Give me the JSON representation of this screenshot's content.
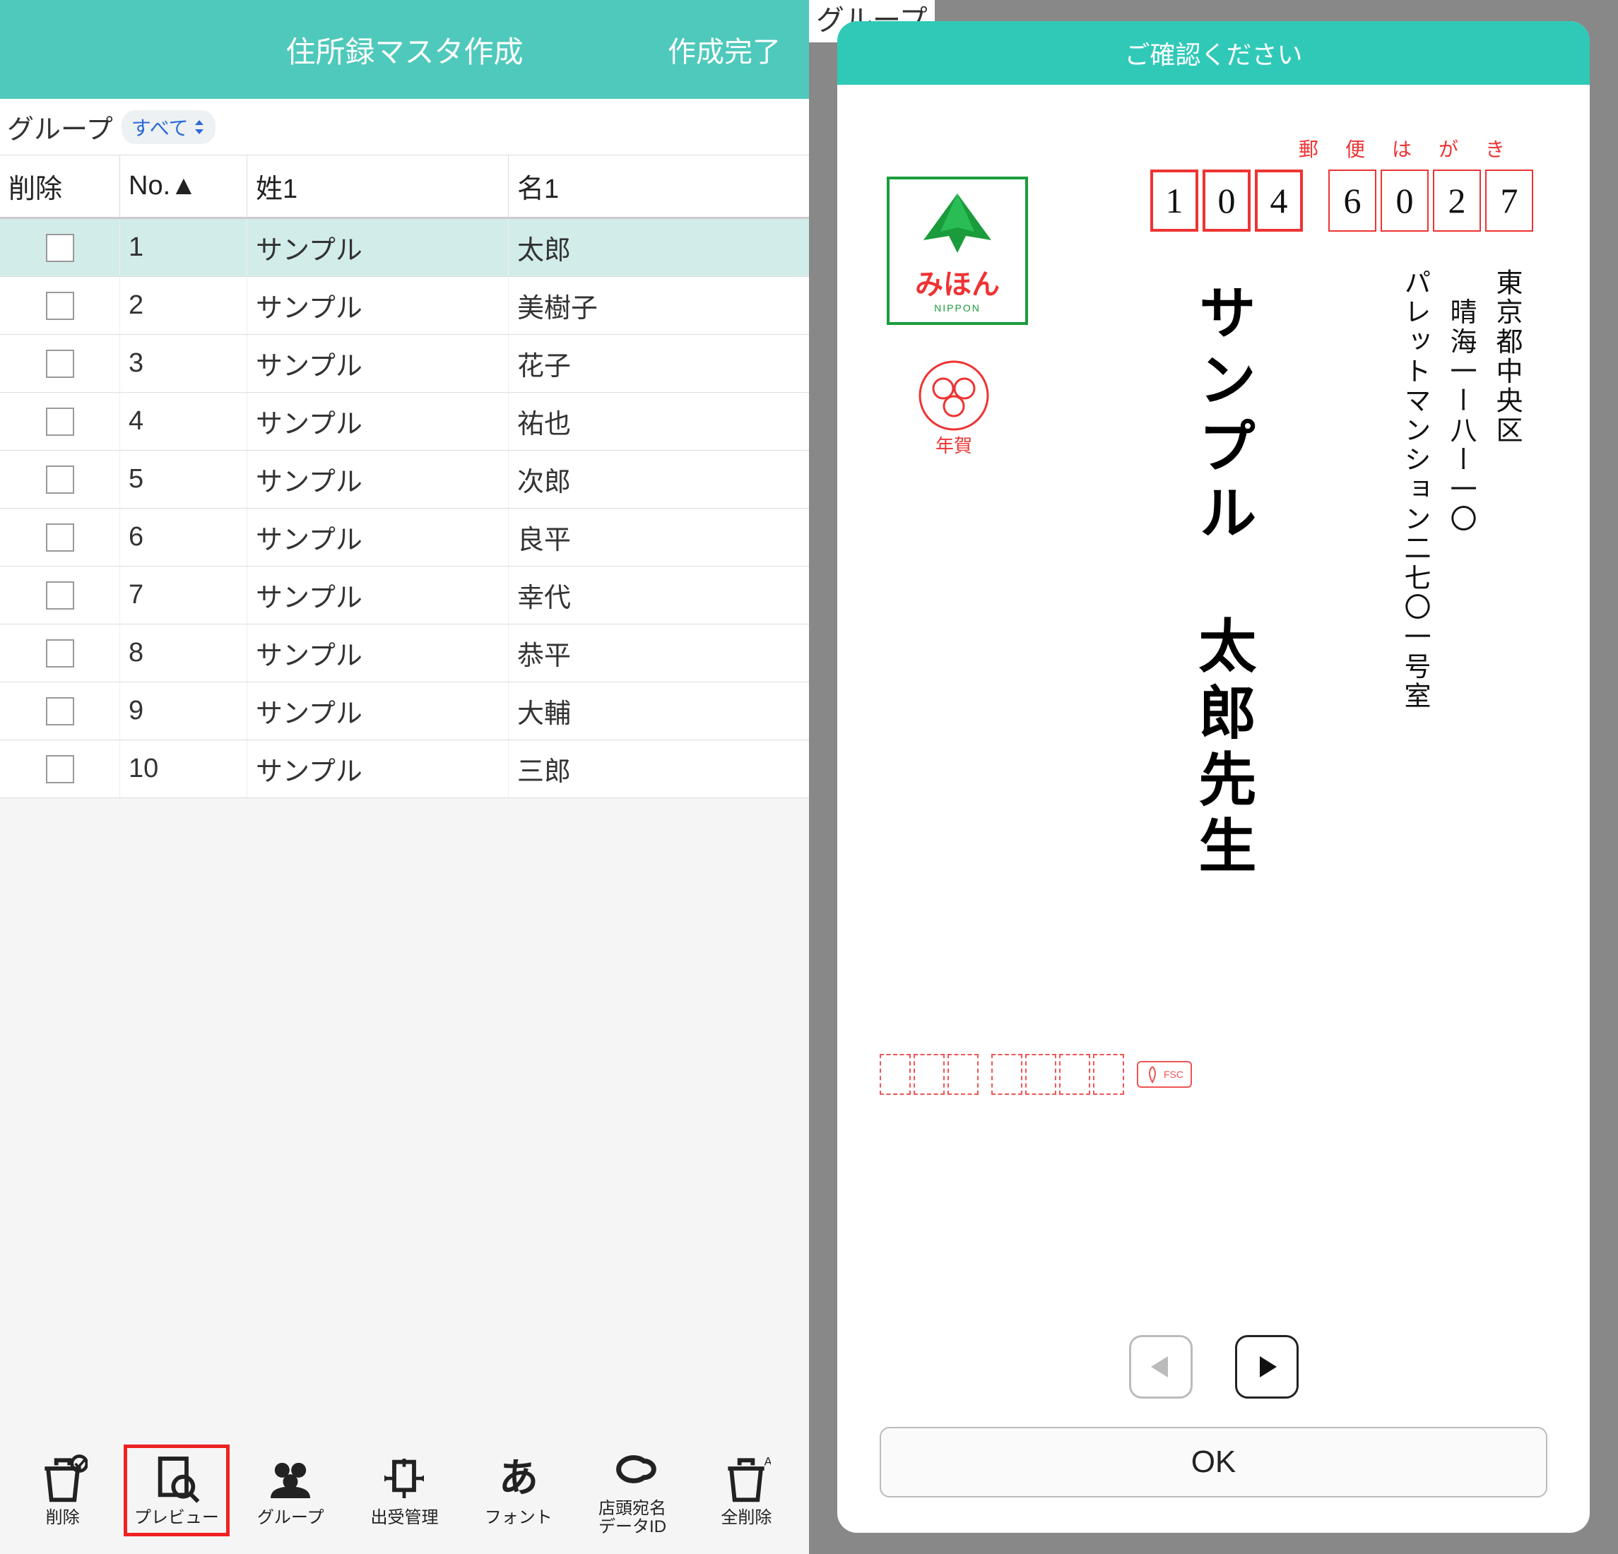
{
  "left": {
    "title": "住所録マスタ作成",
    "done": "作成完了",
    "group_label": "グループ",
    "group_value": "すべて",
    "columns": {
      "del": "削除",
      "no": "No.▲",
      "sei": "姓1",
      "mei": "名1"
    },
    "rows": [
      {
        "no": "1",
        "sei": "サンプル",
        "mei": "太郎",
        "selected": true
      },
      {
        "no": "2",
        "sei": "サンプル",
        "mei": "美樹子",
        "selected": false
      },
      {
        "no": "3",
        "sei": "サンプル",
        "mei": "花子",
        "selected": false
      },
      {
        "no": "4",
        "sei": "サンプル",
        "mei": "祐也",
        "selected": false
      },
      {
        "no": "5",
        "sei": "サンプル",
        "mei": "次郎",
        "selected": false
      },
      {
        "no": "6",
        "sei": "サンプル",
        "mei": "良平",
        "selected": false
      },
      {
        "no": "7",
        "sei": "サンプル",
        "mei": "幸代",
        "selected": false
      },
      {
        "no": "8",
        "sei": "サンプル",
        "mei": "恭平",
        "selected": false
      },
      {
        "no": "9",
        "sei": "サンプル",
        "mei": "大輔",
        "selected": false
      },
      {
        "no": "10",
        "sei": "サンプル",
        "mei": "三郎",
        "selected": false
      }
    ],
    "bottombar": [
      {
        "id": "delete",
        "label": "削除"
      },
      {
        "id": "preview",
        "label": "プレビュー",
        "highlight": true
      },
      {
        "id": "group",
        "label": "グループ"
      },
      {
        "id": "history",
        "label": "出受管理"
      },
      {
        "id": "font",
        "label": "フォント"
      },
      {
        "id": "dataid",
        "label": "店頭宛名\nデータID"
      },
      {
        "id": "delall",
        "label": "全削除"
      }
    ]
  },
  "right": {
    "bg_peek": "グループ",
    "header": "ご確認ください",
    "postal_label": [
      "郵",
      "便",
      "は",
      "が",
      "き"
    ],
    "postal_digits": [
      "1",
      "0",
      "4",
      "6",
      "0",
      "2",
      "7"
    ],
    "address_lines": [
      "東京都中央区",
      "　晴海一ー八ー一〇",
      "パレットマンション二七〇一号室"
    ],
    "name": "サンプル　太郎先生",
    "stamp_text": "みほん",
    "stamp_sub": "NIPPON",
    "nenga": "年賀",
    "fsc": "FSC",
    "ok": "OK"
  }
}
